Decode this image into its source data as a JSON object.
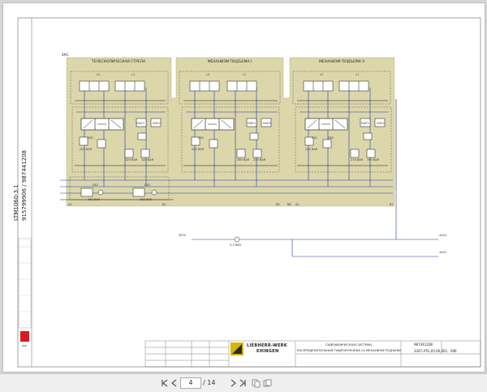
{
  "document": {
    "vertical_labels": {
      "model": "LTM1060-3.1",
      "numbers": "915799906  /  987441208"
    },
    "sections": [
      {
        "title": "ТЕЛЕСКОПИЧЕСКАЯ СТРЕЛА"
      },
      {
        "title": "МЕХАНИЗМ ПОДЪЕМА I"
      },
      {
        "title": "МЕХАНИЗМ ПОДЪЕМА II"
      }
    ],
    "corner_label": "4M1",
    "valve_labels": [
      "L2",
      "L1",
      "L2",
      "L1",
      "L2",
      "L1"
    ],
    "shuttle_labels": [
      "DUE3",
      "DUE2",
      "DUE5",
      "DUE4",
      "DUE1",
      "DUE2"
    ],
    "ds_labels": [
      "DS1",
      "DS2",
      "DS1",
      "DS2"
    ],
    "pressure_labels": [
      "220 BAR",
      "140 BAR",
      "260 BAR",
      "250 BAR",
      "210 BAR",
      "190 BAR",
      "200 BAR",
      "200 BAR",
      "200 BAR"
    ],
    "lower_valves": {
      "left": "DS1",
      "right": "DS2",
      "left_pressure": "260 BAR",
      "right_pressure": "260 BAR"
    },
    "port_labels": [
      "A2",
      "B2",
      "B5",
      "B6",
      "A1",
      "B1"
    ],
    "center_line": {
      "label": "0,3 BAR",
      "left_tag": "ZETA",
      "right_tag_top": "4U10",
      "right_tag_bottom": "4A31"
    },
    "title_block": {
      "title_line1": "ГИДРАВЛИЧЕСКАЯ СИСТЕМА",
      "title_line2": "РАСПРЕДЕЛИТЕЛЬНАЯ ГИДРОКОРОБКА LS МЕХАНИЗМ ПОДЪЕМА III",
      "drawing_no": "987441208",
      "sheet_no": "3367-ATG,05,00,001.. 006",
      "brand_line1": "LIEBHERR-WERK",
      "brand_line2": "EHINGEN"
    }
  },
  "viewer": {
    "current_page": "4",
    "total_pages": "/ 14"
  }
}
